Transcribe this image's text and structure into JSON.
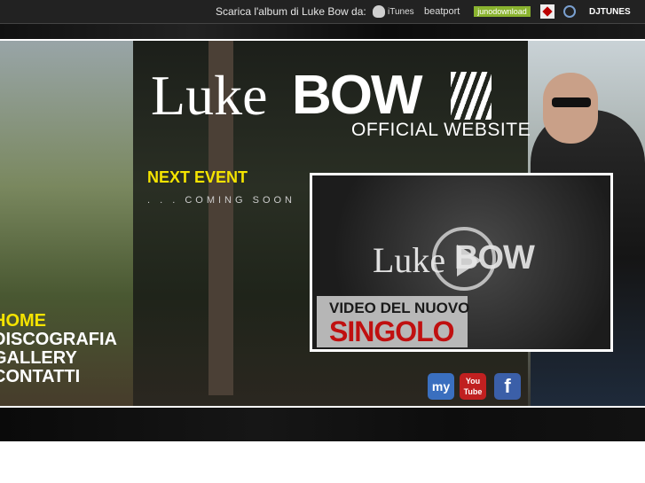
{
  "topbar": {
    "label": "Scarica l'album di Luke Bow da:",
    "stores": [
      "iTunes",
      "beatport",
      "junodownload",
      "DJTUNES"
    ]
  },
  "logo": {
    "luke": "Luke",
    "bow": "BOW",
    "official": "OFFICIAL WEBSITE"
  },
  "event": {
    "title": "NEXT EVENT",
    "subtitle": ". . .  COMING SOON"
  },
  "video": {
    "logo_luke": "Luke",
    "logo_bow": "BOW",
    "caption_line1": "VIDEO DEL NUOVO",
    "caption_line2": "SINGOLO"
  },
  "nav": {
    "items": [
      "HOME",
      "DISCOGRAFIA",
      "GALLERY",
      "CONTATTI"
    ]
  },
  "social": {
    "myspace": "my",
    "youtube_line1": "You",
    "youtube_line2": "Tube",
    "facebook": "f"
  },
  "colors": {
    "accent_yellow": "#f5e400",
    "caption_red": "#c01010"
  }
}
